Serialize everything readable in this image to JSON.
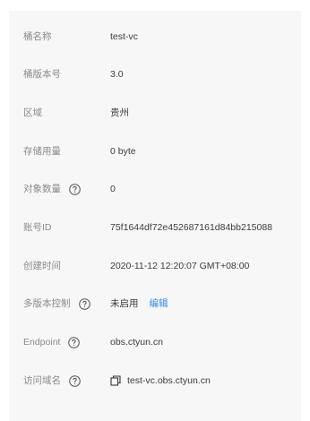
{
  "details": {
    "bucket_name_label": "桶名称",
    "bucket_name_value": "test-vc",
    "bucket_version_label": "桶版本号",
    "bucket_version_value": "3.0",
    "region_label": "区域",
    "region_value": "贵州",
    "storage_used_label": "存储用量",
    "storage_used_value": "0 byte",
    "object_count_label": "对象数量",
    "object_count_value": "0",
    "account_id_label": "账号ID",
    "account_id_value": "75f1644df72e452687161d84bb215088",
    "created_time_label": "创建时间",
    "created_time_value": "2020-11-12 12:20:07 GMT+08:00",
    "versioning_label": "多版本控制",
    "versioning_value": "未启用",
    "versioning_edit": "编辑",
    "endpoint_label": "Endpoint",
    "endpoint_value": "obs.ctyun.cn",
    "domain_label": "访问域名",
    "domain_value": "test-vc.obs.ctyun.cn"
  },
  "icons": {
    "help": "question-circle-icon",
    "copy": "copy-icon"
  },
  "colors": {
    "label": "#8a8a8a",
    "value": "#3b3b3b",
    "link": "#2d8cf0",
    "panel_bg": "#f7f7f7"
  }
}
